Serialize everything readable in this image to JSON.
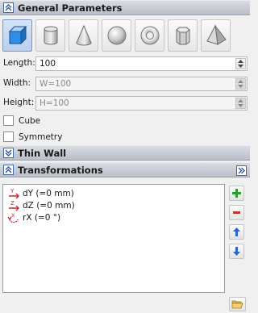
{
  "sections": {
    "general": "General Parameters",
    "thin_wall": "Thin Wall",
    "transformations": "Transformations"
  },
  "shapes": [
    "box",
    "cylinder",
    "cone",
    "sphere",
    "torus",
    "prism",
    "pyramid"
  ],
  "selected_shape": "box",
  "fields": {
    "length": {
      "label": "Length:",
      "value": "100"
    },
    "width": {
      "label": "Width:",
      "value": "W=100"
    },
    "height": {
      "label": "Height:",
      "value": "H=100"
    }
  },
  "checkboxes": {
    "cube": {
      "label": "Cube",
      "checked": false
    },
    "symmetry": {
      "label": "Symmetry",
      "checked": false
    }
  },
  "transformations": [
    {
      "icon_text": "Y",
      "label": "dY (=0 mm)"
    },
    {
      "icon_text": "Z",
      "label": "dZ (=0 mm)"
    },
    {
      "icon_text": "X",
      "label": "rX (=0 °)"
    }
  ],
  "side_buttons": [
    "add-icon",
    "remove-icon",
    "arrow-up-icon",
    "arrow-down-icon"
  ],
  "colors": {
    "header_gradient_top": "#d9dce2",
    "header_gradient_bottom": "#b9bec8",
    "accent_blue": "#2f63c8",
    "add_green": "#2e9b2e",
    "remove_red": "#d12a2a",
    "transform_red": "#cc1f1f"
  }
}
